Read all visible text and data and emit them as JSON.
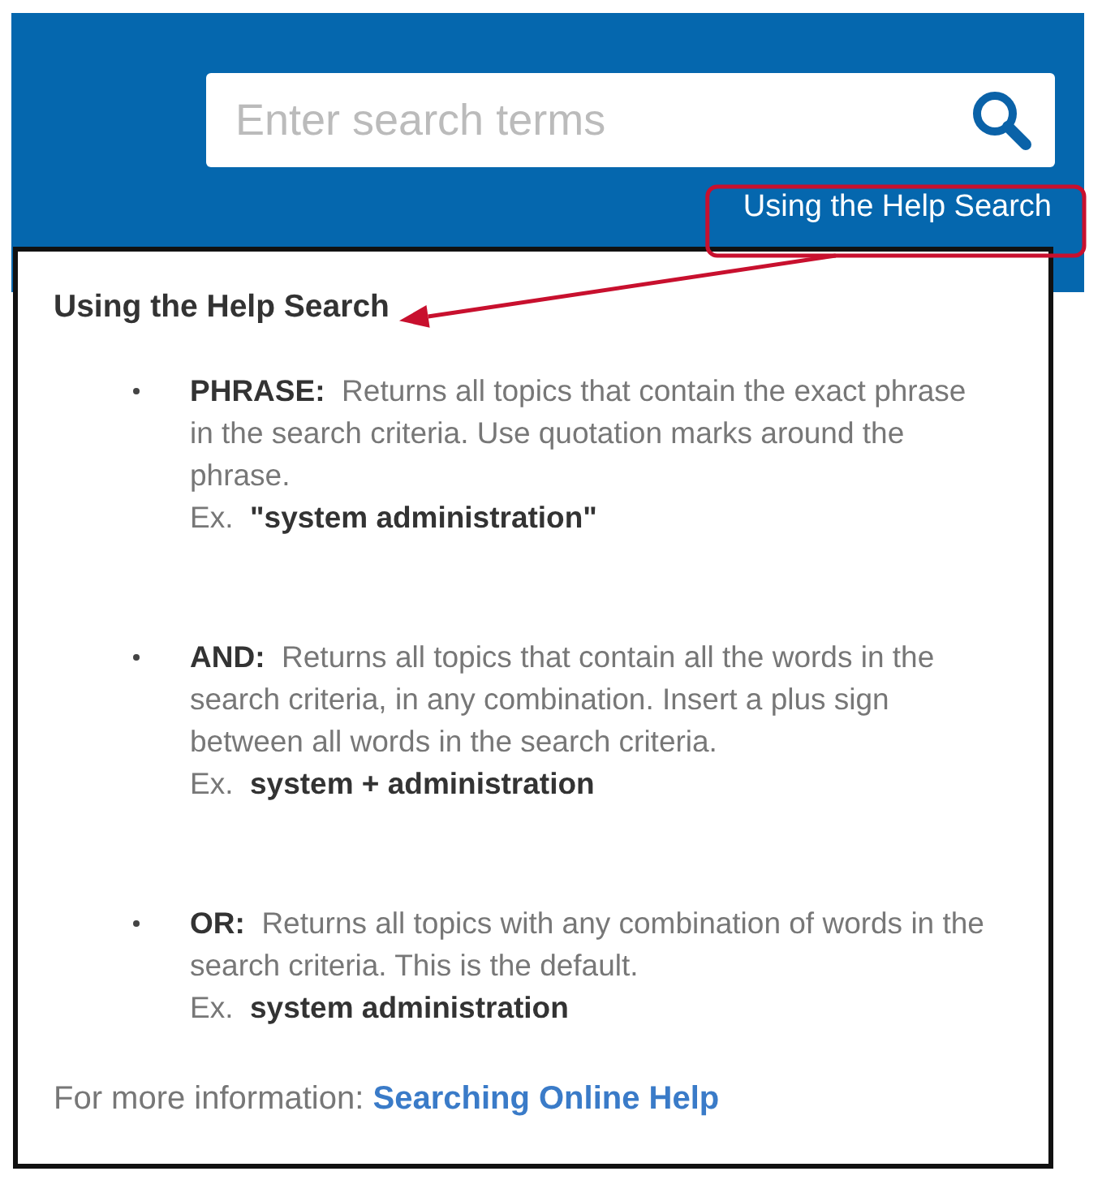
{
  "search": {
    "placeholder": "Enter search terms"
  },
  "help_link": {
    "label": "Using the Help Search",
    "highlighted": true
  },
  "panel": {
    "title": "Using the Help Search",
    "items": [
      {
        "text": "**PHRASE:**  Returns all topics that contain the exact phrase in the search criteria. Use quotation marks around the phrase.",
        "example": "Ex.  **\"system administration\"**"
      },
      {
        "text": "**AND:**  Returns all topics that contain all the words in the search criteria, in any combination. Insert a plus sign between all words in the search criteria.",
        "example": "Ex.  **system + administration**"
      },
      {
        "text": "**OR:**  Returns all topics with any combination of words in the search criteria. This is the default.",
        "example": "Ex.  **system administration**"
      }
    ],
    "footer": {
      "text": "For more information:",
      "link": "Searching Online Help"
    }
  },
  "callout": {
    "arrow": true
  }
}
